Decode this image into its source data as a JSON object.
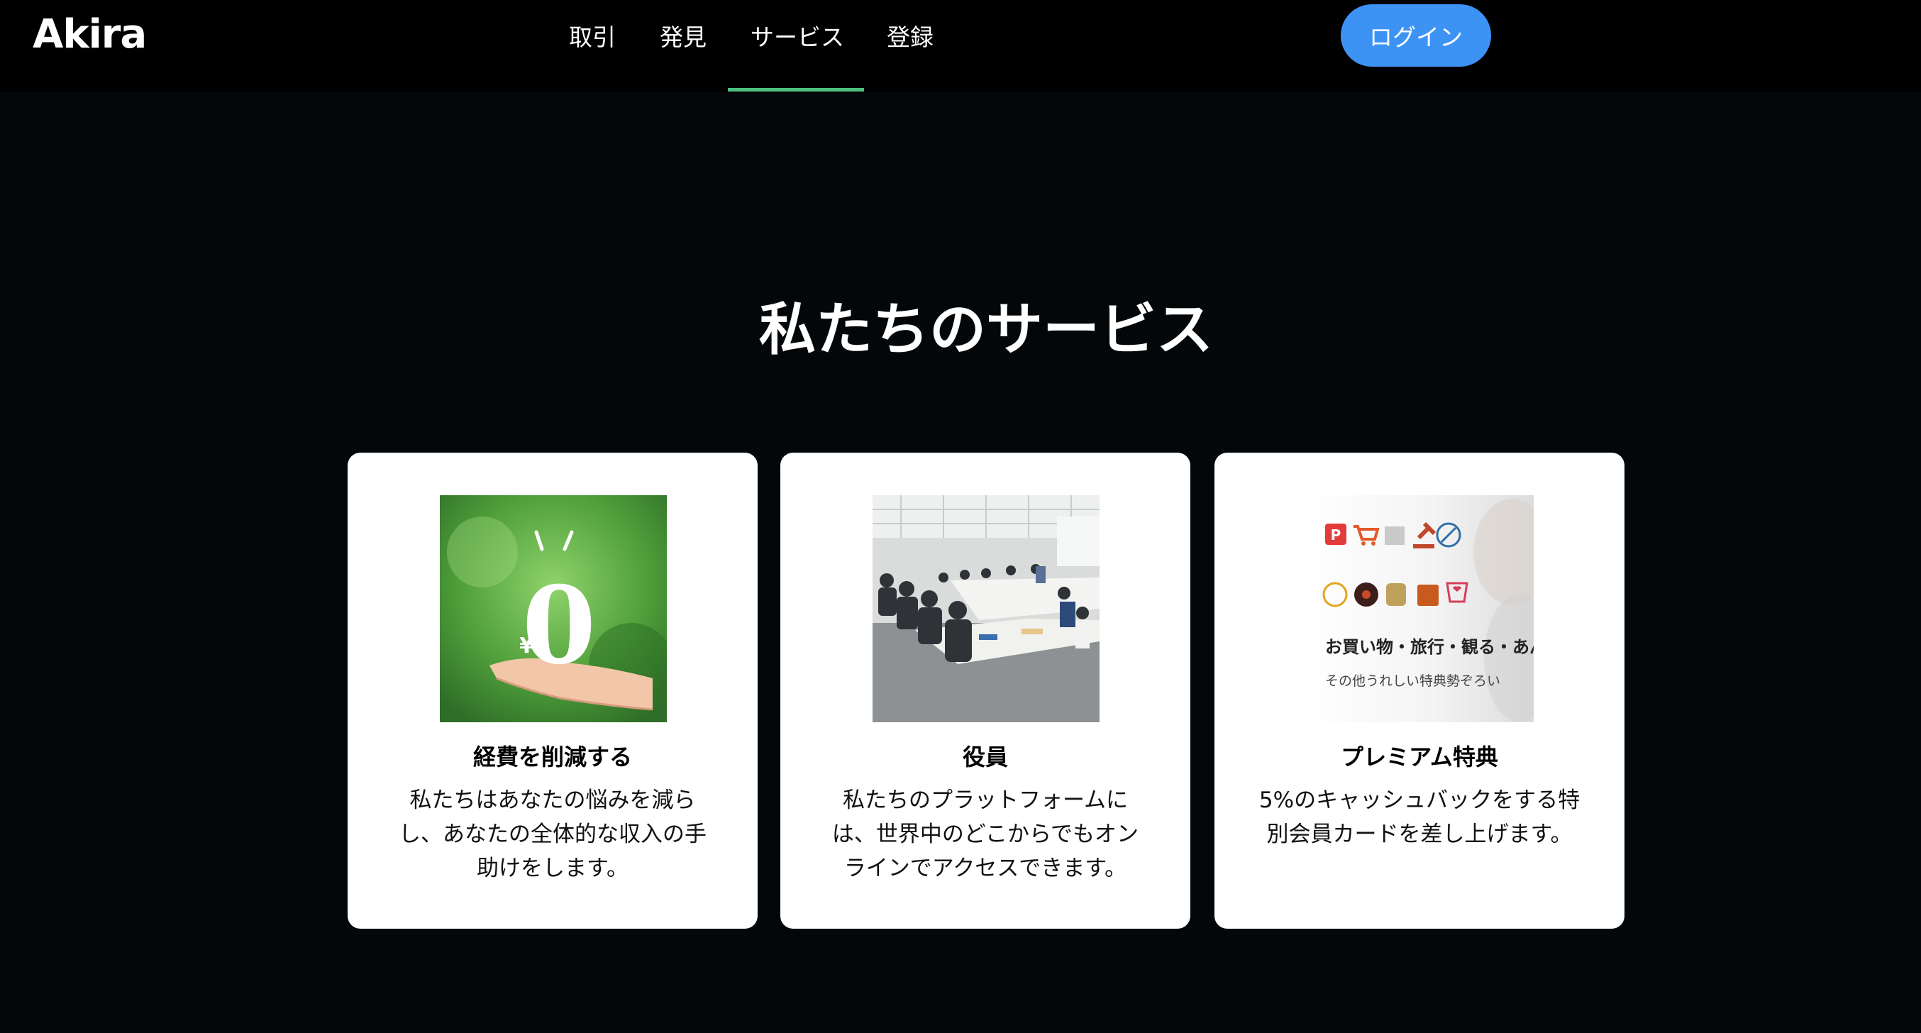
{
  "header": {
    "logo": "Akira",
    "nav": [
      {
        "label": "取引"
      },
      {
        "label": "発見"
      },
      {
        "label": "サービス",
        "active": true
      },
      {
        "label": "登録"
      }
    ],
    "login_label": "ログイン",
    "accent_color": "#3d93f4",
    "active_underline_color": "#4fbf7f"
  },
  "services": {
    "title": "私たちのサービス",
    "cards": [
      {
        "title": "経費を削減する",
        "description": "私たちはあなたの悩みを減らし、あなたの全体的な収入の手助けをします。",
        "image": {
          "yen": "¥",
          "zero": "0"
        }
      },
      {
        "title": "役員",
        "description": "私たちのプラットフォームには、世界中のどこからでもオンラインでアクセスできます。"
      },
      {
        "title": "プレミアム特典",
        "description": "5%のキャッシュバックをする特別会員カードを差し上げます。",
        "image": {
          "caption1": "お買い物・旅行・観る・あんしん",
          "caption2": "その他うれしい特典勢ぞろい"
        }
      }
    ]
  }
}
